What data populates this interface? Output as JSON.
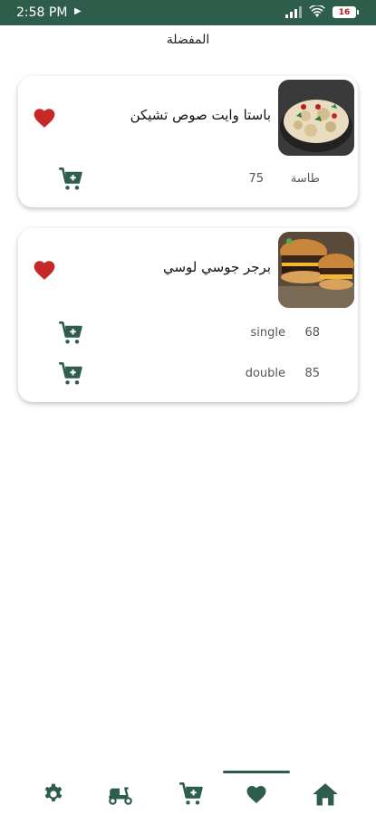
{
  "status": {
    "time": "2:58 PM",
    "battery": "16"
  },
  "header": {
    "title": "المفضلة"
  },
  "favorites": [
    {
      "name": "باستا وايت صوص تشيكن",
      "variants": [
        {
          "label": "طاسة",
          "price": "75"
        }
      ]
    },
    {
      "name": "برجر جوسي لوسي",
      "variants": [
        {
          "label": "single",
          "price": "68"
        },
        {
          "label": "double",
          "price": "85"
        }
      ]
    }
  ],
  "bottom_nav": {
    "items": [
      "settings-icon",
      "scooter-icon",
      "cart-plus-icon",
      "heart-icon",
      "home-icon"
    ],
    "active": "heart-icon"
  },
  "colors": {
    "primary": "#2f5d4b",
    "heart": "#c62828"
  }
}
